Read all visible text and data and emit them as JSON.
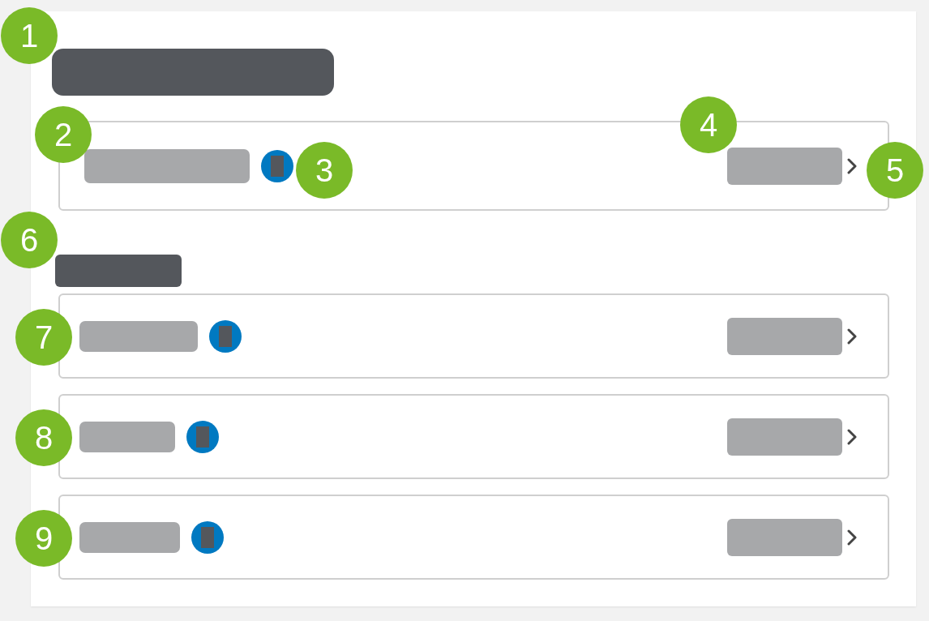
{
  "sections": [
    {
      "heading": {
        "kind": "placeholder"
      },
      "rows": [
        {
          "kind": "link-row"
        }
      ]
    },
    {
      "heading": {
        "kind": "placeholder"
      },
      "rows": [
        {
          "kind": "link-row"
        },
        {
          "kind": "link-row"
        },
        {
          "kind": "link-row"
        }
      ]
    }
  ],
  "callouts": [
    "1",
    "2",
    "3",
    "4",
    "5",
    "6",
    "7",
    "8",
    "9"
  ]
}
